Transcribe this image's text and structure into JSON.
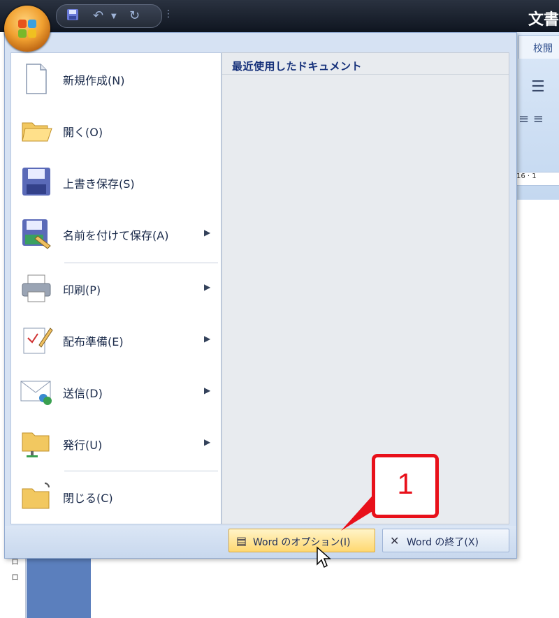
{
  "window": {
    "title": "文書"
  },
  "quick_access": {
    "icons": [
      "save-icon",
      "undo-icon",
      "dropdown-icon",
      "redo-icon"
    ]
  },
  "ribbon": {
    "tab_label": "校閲",
    "ruler_text": "16 · 1"
  },
  "menu": {
    "items": [
      {
        "label": "新規作成(N)",
        "icon": "new-document-icon",
        "has_submenu": false
      },
      {
        "label": "開く(O)",
        "icon": "open-folder-icon",
        "has_submenu": false
      },
      {
        "label": "上書き保存(S)",
        "icon": "save-icon",
        "has_submenu": false
      },
      {
        "label": "名前を付けて保存(A)",
        "icon": "save-as-icon",
        "has_submenu": true
      },
      {
        "label": "印刷(P)",
        "icon": "printer-icon",
        "has_submenu": true
      },
      {
        "label": "配布準備(E)",
        "icon": "prepare-icon",
        "has_submenu": true
      },
      {
        "label": "送信(D)",
        "icon": "send-icon",
        "has_submenu": true
      },
      {
        "label": "発行(U)",
        "icon": "publish-icon",
        "has_submenu": true
      },
      {
        "label": "閉じる(C)",
        "icon": "close-folder-icon",
        "has_submenu": false
      }
    ],
    "recent_documents_title": "最近使用したドキュメント",
    "options_button": "Word のオプション(I)",
    "exit_button": "Word の終了(X)"
  },
  "callout": {
    "number": "1"
  },
  "left_strip": [
    "ロ",
    "ロ"
  ],
  "colors": {
    "accent": "#e8101a",
    "menu_bg": "#d6e2f3",
    "highlight": "#ffd870"
  }
}
